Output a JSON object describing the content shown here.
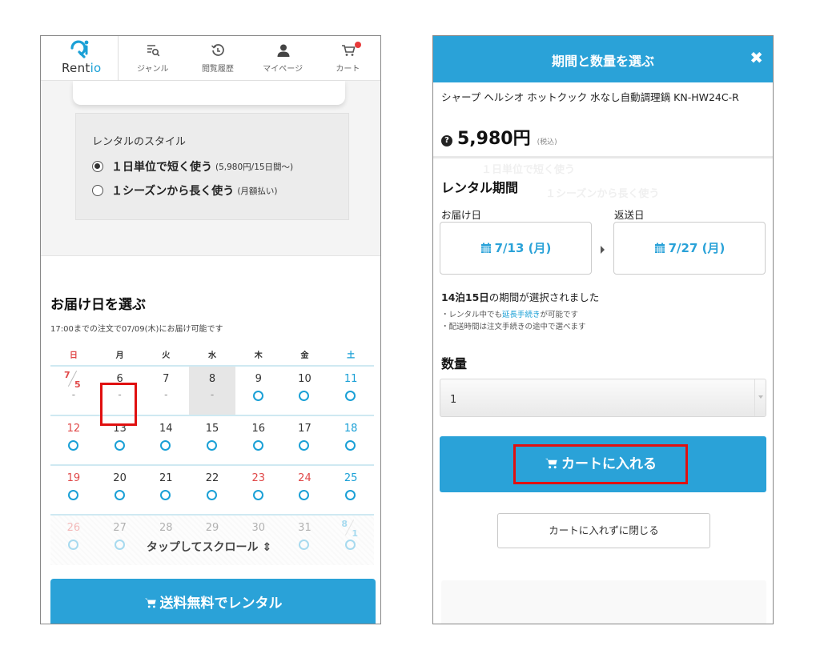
{
  "left": {
    "nav": {
      "logo_main": "Rent",
      "logo_accent": "io",
      "items": [
        {
          "label": "ジャンル",
          "icon": "genre-search-icon"
        },
        {
          "label": "閲覧履歴",
          "icon": "history-icon"
        },
        {
          "label": "マイページ",
          "icon": "user-icon"
        },
        {
          "label": "カート",
          "icon": "cart-icon"
        }
      ]
    },
    "rental_style": {
      "title": "レンタルのスタイル",
      "options": [
        {
          "label": "１日単位で短く使う",
          "note": "(5,980円/15日間〜)",
          "selected": true
        },
        {
          "label": "１シーズンから長く使う",
          "note": "(月額払い)",
          "selected": false
        }
      ]
    },
    "delivery": {
      "title": "お届け日を選ぶ",
      "note": "17:00までの注文で07/09(木)にお届け可能です"
    },
    "calendar": {
      "weekdays": [
        "日",
        "月",
        "火",
        "水",
        "木",
        "金",
        "土"
      ],
      "rows": [
        [
          "7",
          "6",
          "7",
          "8",
          "9",
          "10",
          "11"
        ],
        [
          "12",
          "13",
          "14",
          "15",
          "16",
          "17",
          "18"
        ],
        [
          "19",
          "20",
          "21",
          "22",
          "23",
          "24",
          "25"
        ],
        [
          "26",
          "27",
          "28",
          "29",
          "30",
          "31",
          "8"
        ]
      ],
      "first_denominator": "5",
      "last_denominator": "1",
      "unavailable_mark": "-",
      "scroll_hint": "タップしてスクロール ⇕"
    },
    "rent_button": "送料無料でレンタル"
  },
  "modal": {
    "title": "期間と数量を選ぶ",
    "close_symbol": "✖",
    "product_name": "シャープ ヘルシオ ホットクック 水なし自動調理鍋 KN-HW24C-R",
    "price": "5,980円",
    "tax": "(税込)",
    "period_title": "レンタル期間",
    "deliver_label": "お届け日",
    "return_label": "返送日",
    "deliver_date": "7/13 (月)",
    "return_date": "7/27 (月)",
    "selected_bold": "14泊15日",
    "selected_rest": "の期間が選択されました",
    "note1_pre": "・レンタル中でも",
    "note1_link": "延長手続き",
    "note1_post": "が可能です",
    "note2": "・配送時間は注文手続きの途中で選べます",
    "qty_title": "数量",
    "qty_value": "1",
    "cart_button": "カートに入れる",
    "close_button": "カートに入れずに閉じる"
  },
  "colors": {
    "accent": "#2aa2d8",
    "highlight": "#e01010",
    "sunday": "#e04848"
  }
}
